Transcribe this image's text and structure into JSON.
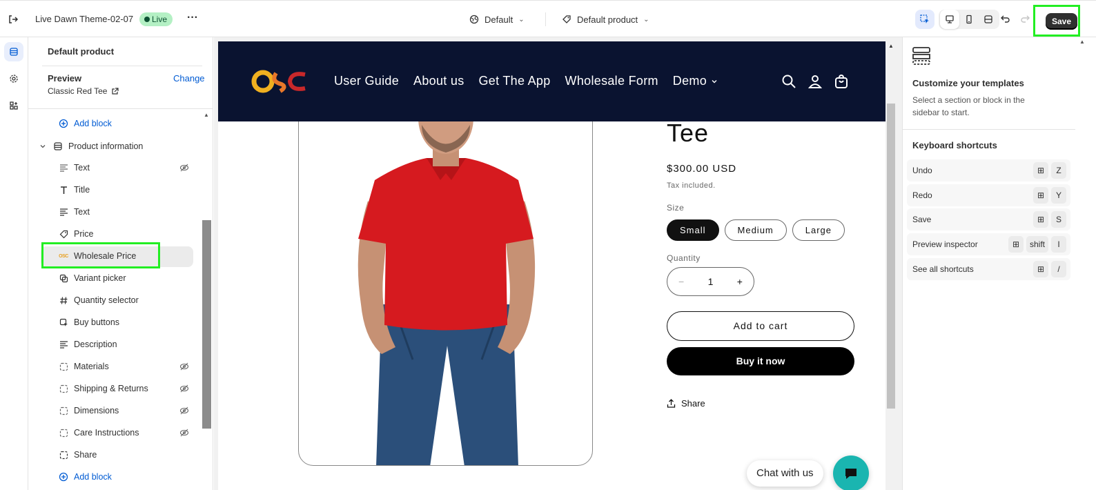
{
  "topbar": {
    "title": "Live Dawn Theme-02-07",
    "status": "Live",
    "more_label": "···",
    "theme_select": "Default",
    "template_select": "Default product",
    "save_label": "Save"
  },
  "sidebar": {
    "title": "Default product",
    "preview_label": "Preview",
    "change_label": "Change",
    "preview_product": "Classic Red Tee",
    "section_name": "Product information",
    "add_block_label": "Add block",
    "blocks": [
      {
        "label": "Text",
        "icon": "text-icon",
        "hidden": true
      },
      {
        "label": "Title",
        "icon": "title-icon",
        "hidden": false
      },
      {
        "label": "Text",
        "icon": "text-icon",
        "hidden": false
      },
      {
        "label": "Price",
        "icon": "price-tag-icon",
        "hidden": false
      },
      {
        "label": "Wholesale Price",
        "icon": "osc-app-icon",
        "hidden": false
      },
      {
        "label": "Variant picker",
        "icon": "variant-picker-icon",
        "hidden": false
      },
      {
        "label": "Quantity selector",
        "icon": "hash-icon",
        "hidden": false
      },
      {
        "label": "Buy buttons",
        "icon": "cursor-click-icon",
        "hidden": false
      },
      {
        "label": "Description",
        "icon": "text-icon",
        "hidden": false
      },
      {
        "label": "Materials",
        "icon": "collapsible-icon",
        "hidden": true
      },
      {
        "label": "Shipping & Returns",
        "icon": "collapsible-icon",
        "hidden": true
      },
      {
        "label": "Dimensions",
        "icon": "collapsible-icon",
        "hidden": true
      },
      {
        "label": "Care Instructions",
        "icon": "collapsible-icon",
        "hidden": true
      },
      {
        "label": "Share",
        "icon": "collapsible-icon",
        "hidden": false
      }
    ]
  },
  "store": {
    "logo_text": "OSC",
    "nav": [
      "User Guide",
      "About us",
      "Get The App",
      "Wholesale Form",
      "Demo"
    ],
    "product_title": "Tee",
    "price": "$300.00 USD",
    "tax_note": "Tax included.",
    "size_label": "Size",
    "sizes": [
      "Small",
      "Medium",
      "Large"
    ],
    "selected_size": "Small",
    "quantity_label": "Quantity",
    "quantity_value": "1",
    "qty_minus": "−",
    "qty_plus": "+",
    "add_to_cart": "Add to cart",
    "buy_now": "Buy it now",
    "share_label": "Share",
    "chat_label": "Chat with us"
  },
  "right_panel": {
    "title": "Customize your templates",
    "description": "Select a section or block in the sidebar to start.",
    "shortcuts_title": "Keyboard shortcuts",
    "shortcuts": [
      {
        "label": "Undo",
        "keys": [
          "⊞",
          "Z"
        ]
      },
      {
        "label": "Redo",
        "keys": [
          "⊞",
          "Y"
        ]
      },
      {
        "label": "Save",
        "keys": [
          "⊞",
          "S"
        ]
      },
      {
        "label": "Preview inspector",
        "keys": [
          "⊞",
          "shift",
          "I"
        ]
      },
      {
        "label": "See all shortcuts",
        "keys": [
          "⊞",
          "/"
        ]
      }
    ]
  },
  "colors": {
    "accent_link": "#005bd3",
    "live_badge_bg": "#b4f0c4",
    "store_header_bg": "#0a1330",
    "highlight_frame": "#22ee22",
    "chat_button": "#1ab5b0"
  }
}
